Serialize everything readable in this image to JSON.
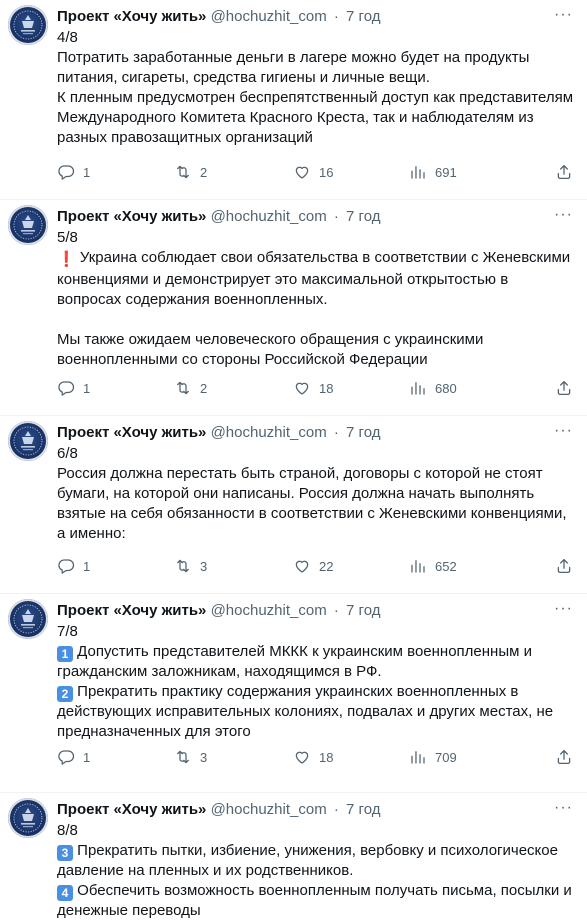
{
  "tweets": [
    {
      "name": "Проект «Хочу жить»",
      "handle": "@hochuzhit_com",
      "time": "7 год",
      "paragraphs": [
        {
          "text": "4/8\nПотратить заработанные деньги в лагере можно будет на продукты питания, сигареты, средства гигиены и личные вещи.\nК пленным предусмотрен беспрепятственный доступ как представителям Международного Комитета Красного Креста, так и наблюдателям из разных правозащитных организаций"
        }
      ],
      "replies": "1",
      "retweets": "2",
      "likes": "16",
      "views": "691"
    },
    {
      "name": "Проект «Хочу жить»",
      "handle": "@hochuzhit_com",
      "time": "7 год",
      "paragraphs": [
        {
          "text": "5/8"
        },
        {
          "emoji": "❗",
          "text": " Украина соблюдает свои обязательства в соответствии с Женевскими конвенциями и демонстрирует это максимальной открытостью в вопросах содержания военнопленных."
        },
        {
          "text": "\nМы также ожидаем человеческого обращения с украинскими военнопленными со стороны Российской Федерации"
        }
      ],
      "replies": "1",
      "retweets": "2",
      "likes": "18",
      "views": "680"
    },
    {
      "name": "Проект «Хочу жить»",
      "handle": "@hochuzhit_com",
      "time": "7 год",
      "paragraphs": [
        {
          "text": "6/8\nРоссия должна перестать быть страной, договоры с которой не стоят бумаги, на которой они написаны. Россия должна начать выполнять взятые на себя обязанности в соответствии с Женевскими конвенциями, а именно:"
        }
      ],
      "replies": "1",
      "retweets": "3",
      "likes": "22",
      "views": "652"
    },
    {
      "name": "Проект «Хочу жить»",
      "handle": "@hochuzhit_com",
      "time": "7 год",
      "paragraphs": [
        {
          "text": "7/8"
        },
        {
          "keycap": "1",
          "text": " Допустить представителей МККК к украинским военнопленным и гражданским заложникам, находящимся в РФ."
        },
        {
          "keycap": "2",
          "text": " Прекратить практику содержания украинских военнопленных в действующих исправительных колониях, подвалах и других местах, не предназначенных для этого"
        }
      ],
      "replies": "1",
      "retweets": "3",
      "likes": "18",
      "views": "709"
    },
    {
      "name": "Проект «Хочу жить»",
      "handle": "@hochuzhit_com",
      "time": "7 год",
      "paragraphs": [
        {
          "text": "8/8"
        },
        {
          "keycap": "3",
          "text": " Прекратить пытки, избиение, унижения, вербовку и психологическое давление на пленных и их родственников."
        },
        {
          "keycap": "4",
          "text": " Обеспечить возможность военнопленным получать письма, посылки и денежные переводы"
        }
      ]
    }
  ],
  "icons": {
    "reply": "reply-icon",
    "retweet": "retweet-icon",
    "like": "heart-icon",
    "views": "views-icon",
    "share": "share-icon",
    "more": "more-icon",
    "avatar": "avatar"
  },
  "colors": {
    "text": "#0f1419",
    "muted": "#536471",
    "divider": "#eff3f4",
    "avatar": "#1a3366",
    "keycap": "#4a90e2"
  }
}
